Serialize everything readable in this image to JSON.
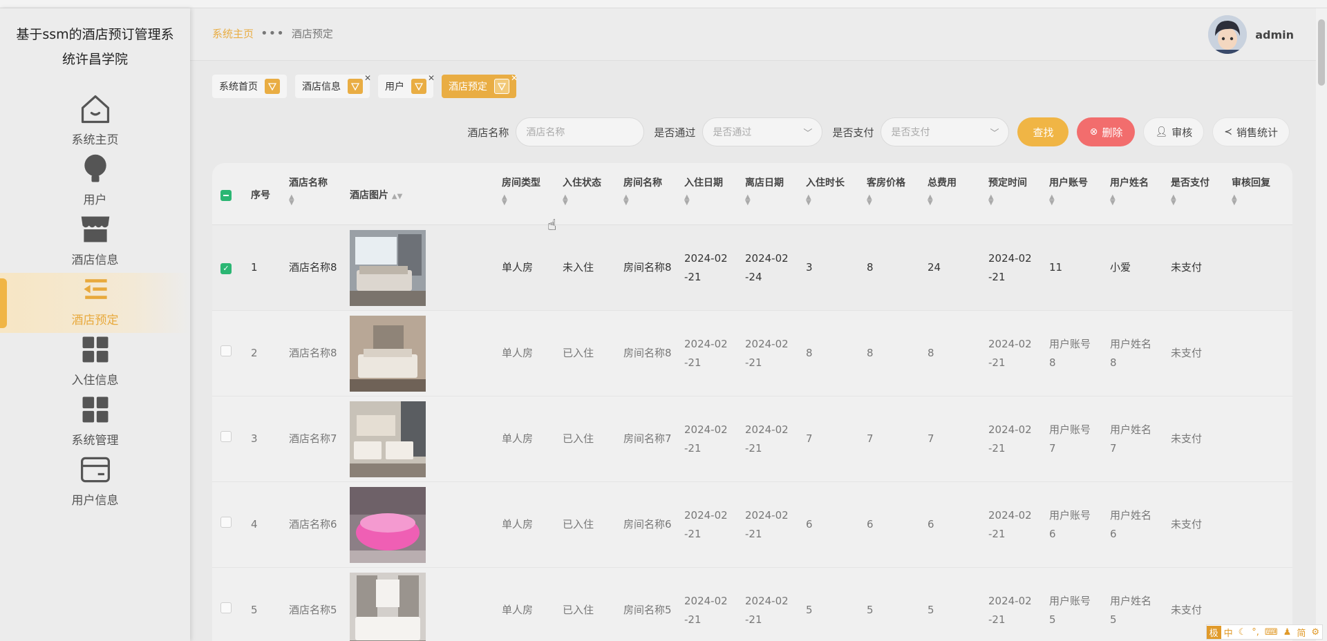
{
  "sidebar": {
    "title": "基于ssm的酒店预订管理系统许昌学院",
    "items": [
      {
        "label": "系统主页",
        "icon": "home-icon"
      },
      {
        "label": "用户",
        "icon": "bulb-icon"
      },
      {
        "label": "酒店信息",
        "icon": "shop-icon"
      },
      {
        "label": "酒店预定",
        "icon": "list-icon"
      },
      {
        "label": "入住信息",
        "icon": "grid-icon"
      },
      {
        "label": "系统管理",
        "icon": "grid-icon"
      },
      {
        "label": "用户信息",
        "icon": "card-icon"
      }
    ],
    "active_index": 3
  },
  "header": {
    "breadcrumb_home": "系统主页",
    "breadcrumb_dots": "•••",
    "breadcrumb_current": "酒店预定",
    "user_name": "admin"
  },
  "tags": [
    {
      "label": "系统首页"
    },
    {
      "label": "酒店信息"
    },
    {
      "label": "用户"
    },
    {
      "label": "酒店预定"
    }
  ],
  "search": {
    "hotel_label": "酒店名称",
    "hotel_placeholder": "酒店名称",
    "pass_label": "是否通过",
    "pass_placeholder": "是否通过",
    "pay_label": "是否支付",
    "pay_placeholder": "是否支付",
    "find": "查找",
    "delete": "删除",
    "audit": "审核",
    "stats": "销售统计"
  },
  "table": {
    "headers": [
      "序号",
      "酒店名称",
      "酒店图片",
      "房间类型",
      "入住状态",
      "房间名称",
      "入住日期",
      "离店日期",
      "入住时长",
      "客房价格",
      "总费用",
      "预定时间",
      "用户账号",
      "用户姓名",
      "是否支付",
      "审核回复"
    ],
    "rows": [
      {
        "no": "1",
        "hotel": "酒店名称8",
        "type": "单人房",
        "status": "未入住",
        "room": "房间名称8",
        "in": "2024-02-21",
        "out": "2024-02-24",
        "dur": "3",
        "price": "8",
        "total": "24",
        "book": "2024-02-21",
        "acct": "11",
        "uname": "小爱",
        "paid": "未支付",
        "reply": ""
      },
      {
        "no": "2",
        "hotel": "酒店名称8",
        "type": "单人房",
        "status": "已入住",
        "room": "房间名称8",
        "in": "2024-02-21",
        "out": "2024-02-21",
        "dur": "8",
        "price": "8",
        "total": "8",
        "book": "2024-02-21",
        "acct": "用户账号8",
        "uname": "用户姓名8",
        "paid": "未支付",
        "reply": ""
      },
      {
        "no": "3",
        "hotel": "酒店名称7",
        "type": "单人房",
        "status": "已入住",
        "room": "房间名称7",
        "in": "2024-02-21",
        "out": "2024-02-21",
        "dur": "7",
        "price": "7",
        "total": "7",
        "book": "2024-02-21",
        "acct": "用户账号7",
        "uname": "用户姓名7",
        "paid": "未支付",
        "reply": ""
      },
      {
        "no": "4",
        "hotel": "酒店名称6",
        "type": "单人房",
        "status": "已入住",
        "room": "房间名称6",
        "in": "2024-02-21",
        "out": "2024-02-21",
        "dur": "6",
        "price": "6",
        "total": "6",
        "book": "2024-02-21",
        "acct": "用户账号6",
        "uname": "用户姓名6",
        "paid": "未支付",
        "reply": ""
      },
      {
        "no": "5",
        "hotel": "酒店名称5",
        "type": "单人房",
        "status": "已入住",
        "room": "房间名称5",
        "in": "2024-02-21",
        "out": "2024-02-21",
        "dur": "5",
        "price": "5",
        "total": "5",
        "book": "2024-02-21",
        "acct": "用户账号5",
        "uname": "用户姓名5",
        "paid": "未支付",
        "reply": ""
      }
    ]
  },
  "ime": {
    "brand": "极",
    "lang": "中",
    "simp": "简"
  },
  "colors": {
    "accent": "#f0b545",
    "danger": "#f26d6d",
    "check": "#2bb673"
  }
}
